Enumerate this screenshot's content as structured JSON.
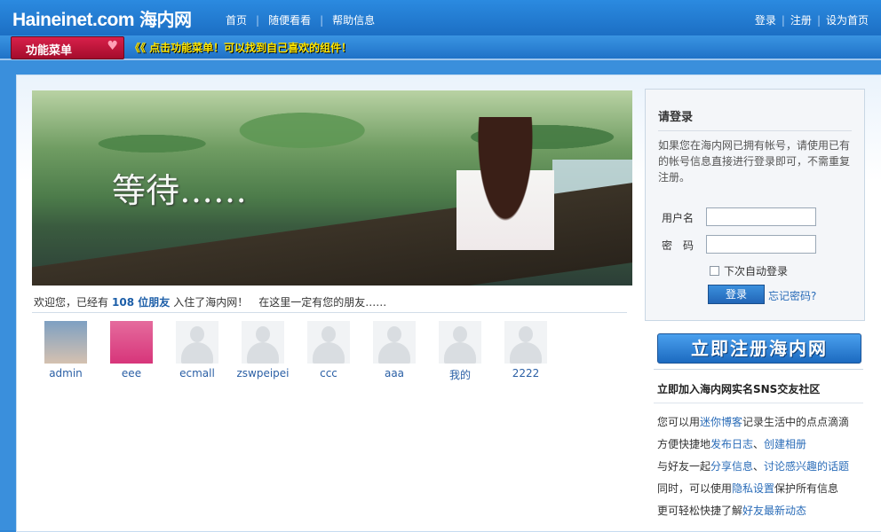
{
  "header": {
    "brand_en": "Haineinet.com",
    "brand_cn": "海内网",
    "nav": [
      "首页",
      "随便看看",
      "帮助信息"
    ],
    "right_links": [
      "登录",
      "注册",
      "设为首页"
    ]
  },
  "menubar": {
    "button_label": "功能菜单",
    "tip": "《《 点击功能菜单！可以找到自己喜欢的组件！"
  },
  "banner": {
    "caption": "等待……"
  },
  "welcome": {
    "prefix": "欢迎您，已经有",
    "count": "108 位朋友",
    "suffix": "入住了海内网！　在这里一定有您的朋友……"
  },
  "members": [
    "admin",
    "eee",
    "ecmall",
    "zswpeipei",
    "ccc",
    "aaa",
    "我的",
    "2222"
  ],
  "login": {
    "title": "请登录",
    "desc": "如果您在海内网已拥有帐号，请使用已有的帐号信息直接进行登录即可，不需重复注册。",
    "username_label": "用户名",
    "password_label": "密　码",
    "remember_label": "下次自动登录",
    "submit_label": "登录",
    "forgot_label": "忘记密码?"
  },
  "register": {
    "button_label": "立即注册海内网",
    "title": "立即加入海内网实名SNS交友社区",
    "lines": [
      {
        "pre": "您可以用",
        "link": "迷你博客",
        "post": "记录生活中的点点滴滴"
      },
      {
        "pre": "方便快捷地",
        "link": "发布日志",
        "mid": "、",
        "link2": "创建相册"
      },
      {
        "pre": "与好友一起",
        "link": "分享信息",
        "mid": "、",
        "link2": "讨论感兴趣的话题"
      },
      {
        "pre": "同时，可以使用",
        "link": "隐私设置",
        "post": "保护所有信息"
      },
      {
        "pre": "更可轻松快捷了解",
        "link": "好友最新动态"
      }
    ]
  }
}
